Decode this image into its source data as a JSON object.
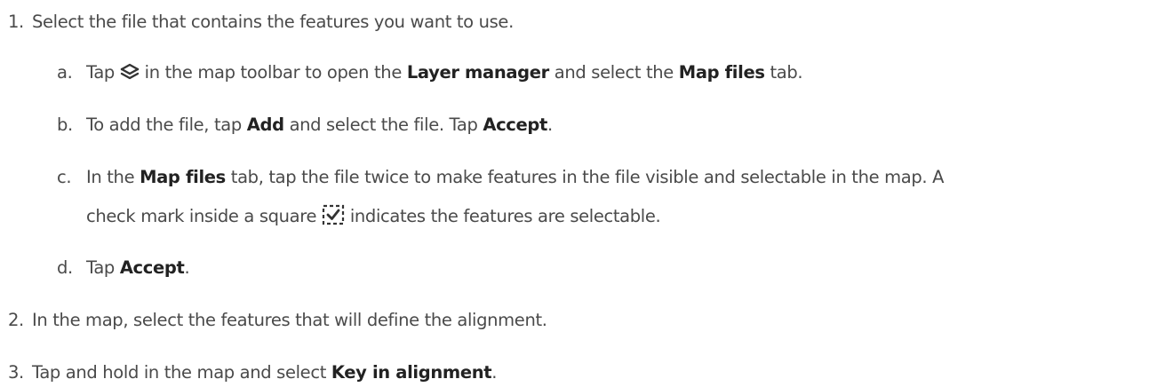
{
  "steps": [
    {
      "marker": "1.",
      "text": "Select the file that contains the features you want to use.",
      "substeps": [
        {
          "marker": "a.",
          "p1": "Tap ",
          "icon": "layers-icon",
          "p2": " in the map toolbar to open the ",
          "b1": "Layer manager",
          "p3": " and select the ",
          "b2": "Map files",
          "p4": " tab."
        },
        {
          "marker": "b.",
          "p1": "To add the file, tap ",
          "b1": "Add",
          "p2": " and select the file. Tap ",
          "b2": "Accept",
          "p3": "."
        },
        {
          "marker": "c.",
          "p1": "In the ",
          "b1": "Map files",
          "p2": " tab, tap the file twice to make features in the file visible and selectable in the map. A",
          "p3": "check mark inside a square ",
          "icon": "selectable-checkbox-icon",
          "p4": " indicates the features are selectable."
        },
        {
          "marker": "d.",
          "p1": "Tap ",
          "b1": "Accept",
          "p2": "."
        }
      ]
    },
    {
      "marker": "2.",
      "text": "In the map, select the features that will define the alignment."
    },
    {
      "marker": "3.",
      "p1": "Tap and hold in the map and select ",
      "b1": "Key in alignment",
      "p2": "."
    }
  ]
}
